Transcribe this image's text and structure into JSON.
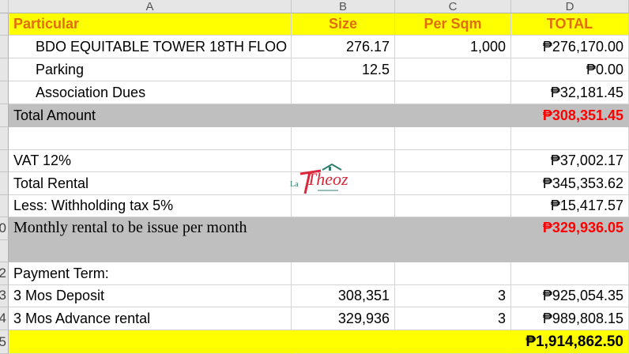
{
  "columns": [
    "A",
    "B",
    "C",
    "D"
  ],
  "row_numbers": [
    "0",
    "2",
    "3",
    "4",
    "5"
  ],
  "header": {
    "particular": "Particular",
    "size": "Size",
    "per_sqm": "Per Sqm",
    "total": "TOTAL"
  },
  "items": [
    {
      "name": "BDO EQUITABLE TOWER 18TH FLOO",
      "size": "276.17",
      "per_sqm": "1,000",
      "total": "₱276,170.00"
    },
    {
      "name": "Parking",
      "size": "12.5",
      "per_sqm": "",
      "total": "₱0.00"
    },
    {
      "name": "Association Dues",
      "size": "",
      "per_sqm": "",
      "total": "₱32,181.45"
    }
  ],
  "total_amount": {
    "label": "Total  Amount",
    "value": "₱308,351.45"
  },
  "vat": {
    "label": "VAT 12%",
    "value": "₱37,002.17"
  },
  "total_rental": {
    "label": "Total Rental",
    "value": "₱345,353.62"
  },
  "withholding": {
    "label": "Less: Withholding tax 5%",
    "value": "₱15,417.57"
  },
  "monthly": {
    "label": "Monthly rental to be issue per month",
    "value": "₱329,936.05"
  },
  "payment_term": {
    "label": "Payment Term:"
  },
  "deposit": {
    "label": "3 Mos Deposit",
    "base": "308,351",
    "months": "3",
    "value": "₱925,054.35"
  },
  "advance": {
    "label": "3  Mos Advance rental",
    "base": "329,936",
    "months": "3",
    "value": "₱989,808.15"
  },
  "grand_total": {
    "value": "₱1,914,862.50"
  },
  "watermark": {
    "brand": "Theoz",
    "prefix": "La"
  },
  "colors": {
    "header_text": "#e26b0a",
    "highlight": "#ffff00",
    "shade": "#bfbfbf",
    "alert": "#ff0000"
  }
}
